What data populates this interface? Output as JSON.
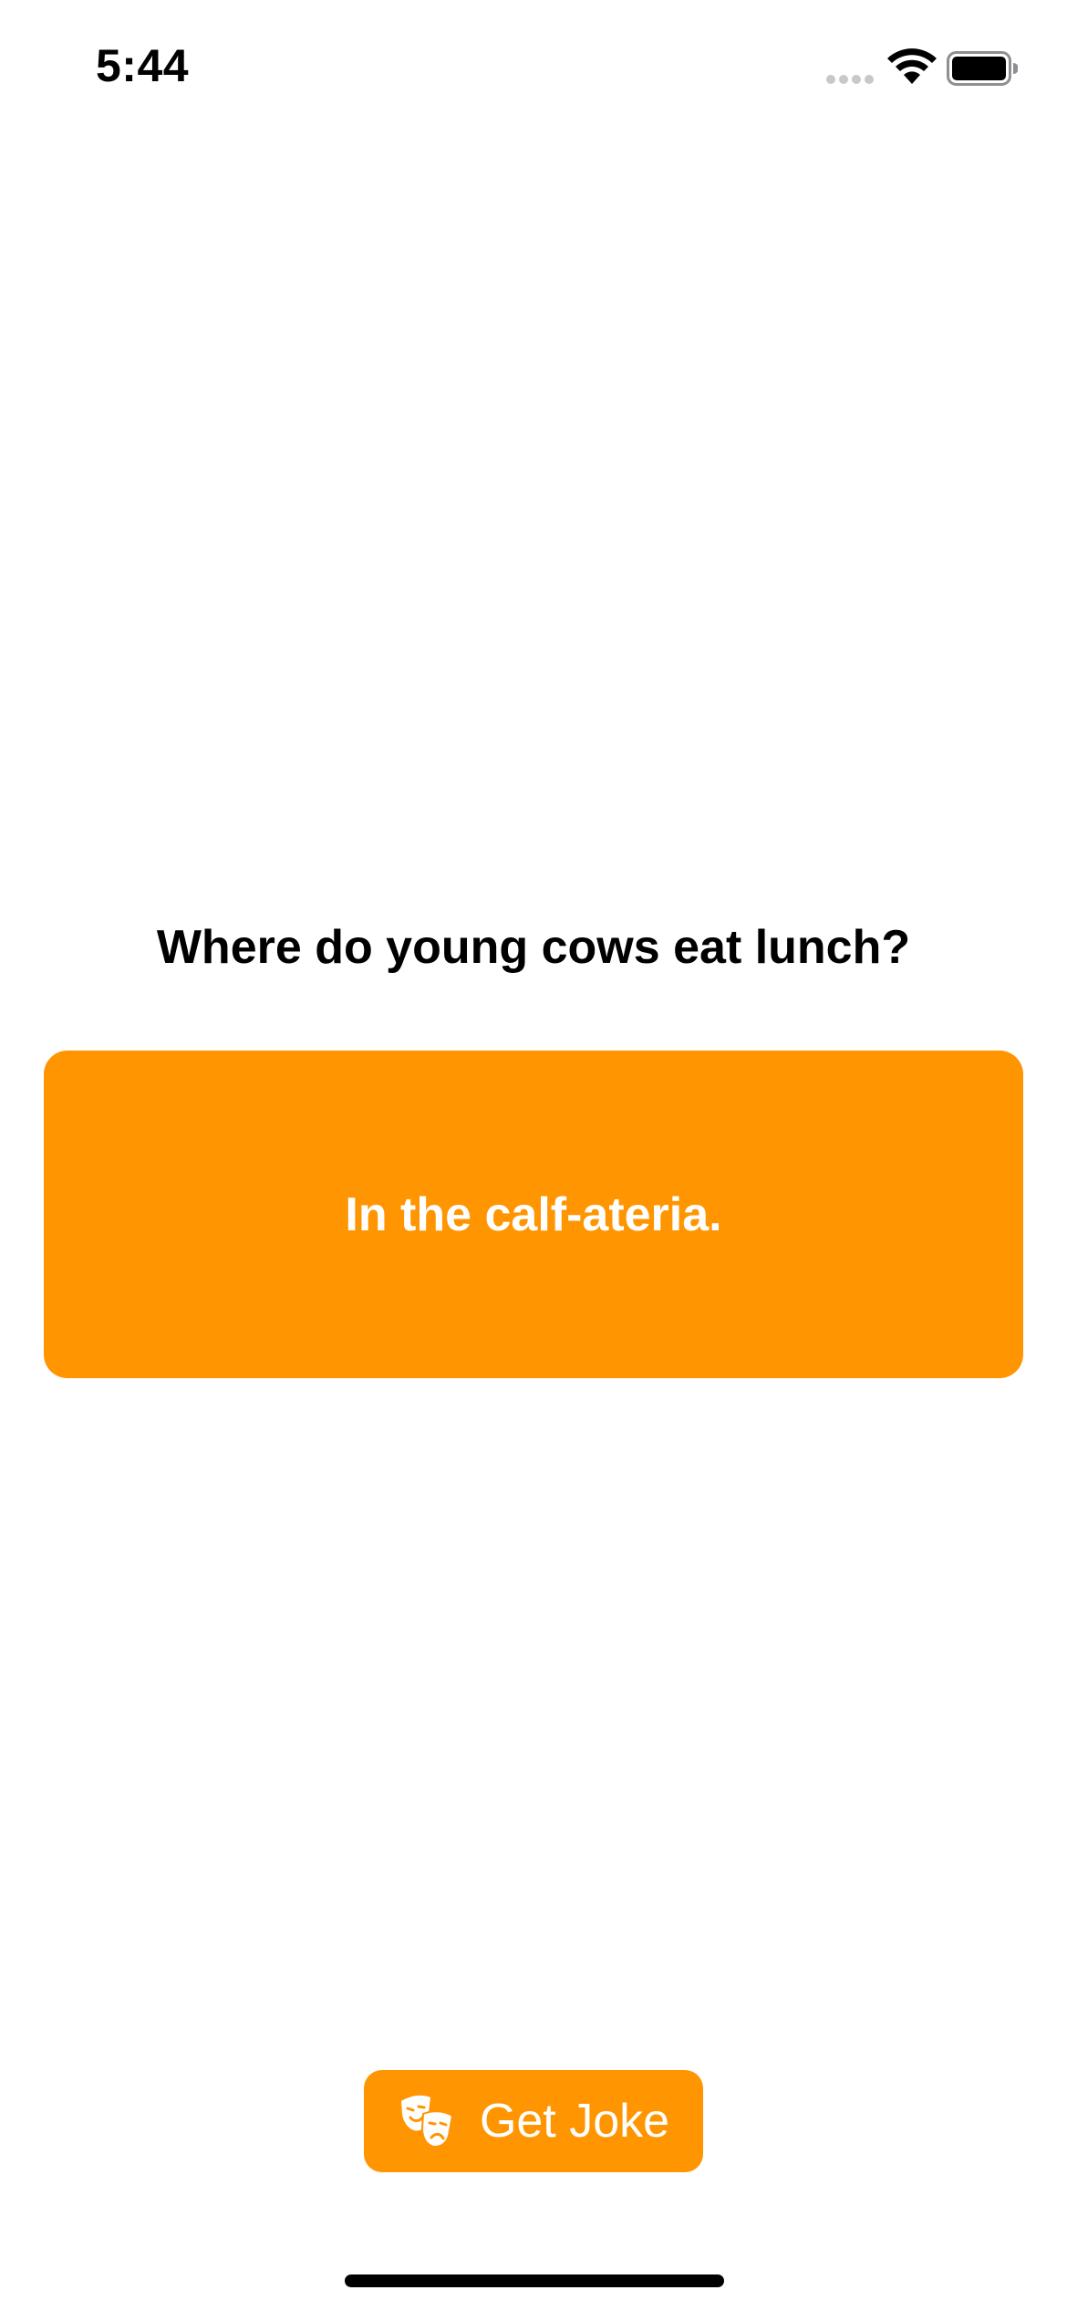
{
  "status_bar": {
    "time": "5:44",
    "icons": [
      "cellular-signal-icon",
      "wifi-icon",
      "battery-icon"
    ]
  },
  "joke": {
    "setup": "Where do young cows eat lunch?",
    "punchline": "In the calf-ateria."
  },
  "get_joke_button": {
    "label": "Get Joke",
    "icon": "theater-masks-icon"
  },
  "colors": {
    "accent": "#FF9500",
    "background": "#FFFFFF",
    "text": "#000000",
    "on_accent_text": "#FFFFFF"
  }
}
